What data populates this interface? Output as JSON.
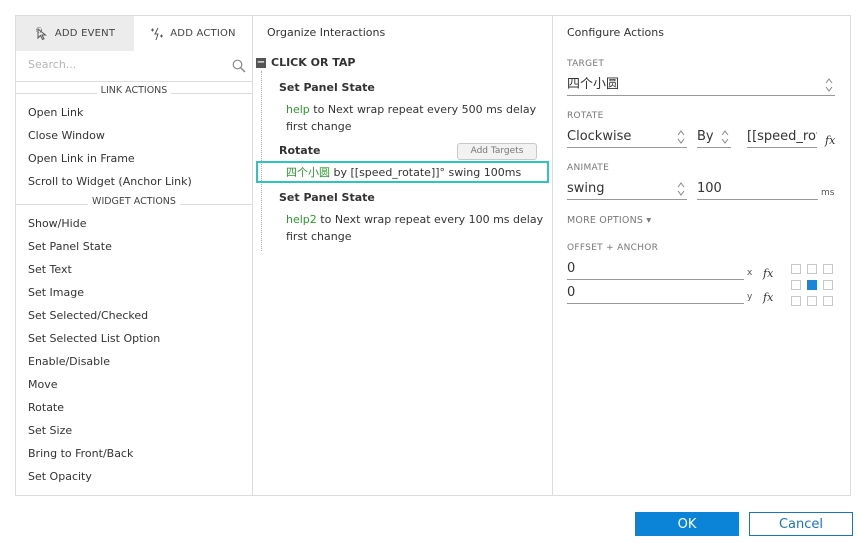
{
  "left": {
    "tabs": [
      {
        "label": "ADD EVENT",
        "icon": "add-event-icon"
      },
      {
        "label": "ADD ACTION",
        "icon": "add-action-icon"
      }
    ],
    "search_placeholder": "Search...",
    "link_actions_header": "LINK ACTIONS",
    "link_actions": [
      "Open Link",
      "Close Window",
      "Open Link in Frame",
      "Scroll to Widget (Anchor Link)"
    ],
    "widget_actions_header": "WIDGET ACTIONS",
    "widget_actions": [
      "Show/Hide",
      "Set Panel State",
      "Set Text",
      "Set Image",
      "Set Selected/Checked",
      "Set Selected List Option",
      "Enable/Disable",
      "Move",
      "Rotate",
      "Set Size",
      "Bring to Front/Back",
      "Set Opacity"
    ]
  },
  "middle": {
    "title": "Organize Interactions",
    "event_label": "CLICK OR TAP",
    "collapse_symbol": "−",
    "cases": [
      {
        "title": "Set Panel State",
        "target": "help",
        "rest": " to Next wrap repeat every 500 ms delay first change"
      },
      {
        "title": "Rotate",
        "add_targets": "Add Targets",
        "target": "四个小圆",
        "rest": " by [[speed_rotate]]° swing 100ms"
      },
      {
        "title": "Set Panel State",
        "target": "help2",
        "rest": " to Next wrap repeat every 100 ms delay first change"
      }
    ]
  },
  "right": {
    "title": "Configure Actions",
    "target_label": "TARGET",
    "target_value": "四个小圆",
    "rotate_label": "ROTATE",
    "rotate_direction": "Clockwise",
    "rotate_by": "By",
    "rotate_value": "[[speed_rotate]]",
    "animate_label": "ANIMATE",
    "animate_type": "swing",
    "animate_duration": "100",
    "animate_unit": "ms",
    "more_options": "MORE OPTIONS ▾",
    "offset_label": "OFFSET + ANCHOR",
    "offset_x": "0",
    "offset_x_unit": "x",
    "offset_y": "0",
    "offset_y_unit": "y",
    "fx_label": "fx",
    "anchor_selected": "center"
  },
  "buttons": {
    "ok": "OK",
    "cancel": "Cancel"
  },
  "colors": {
    "accent": "#0b84d8",
    "target_green": "#2b9a2b",
    "selection": "#2ec4c4"
  }
}
